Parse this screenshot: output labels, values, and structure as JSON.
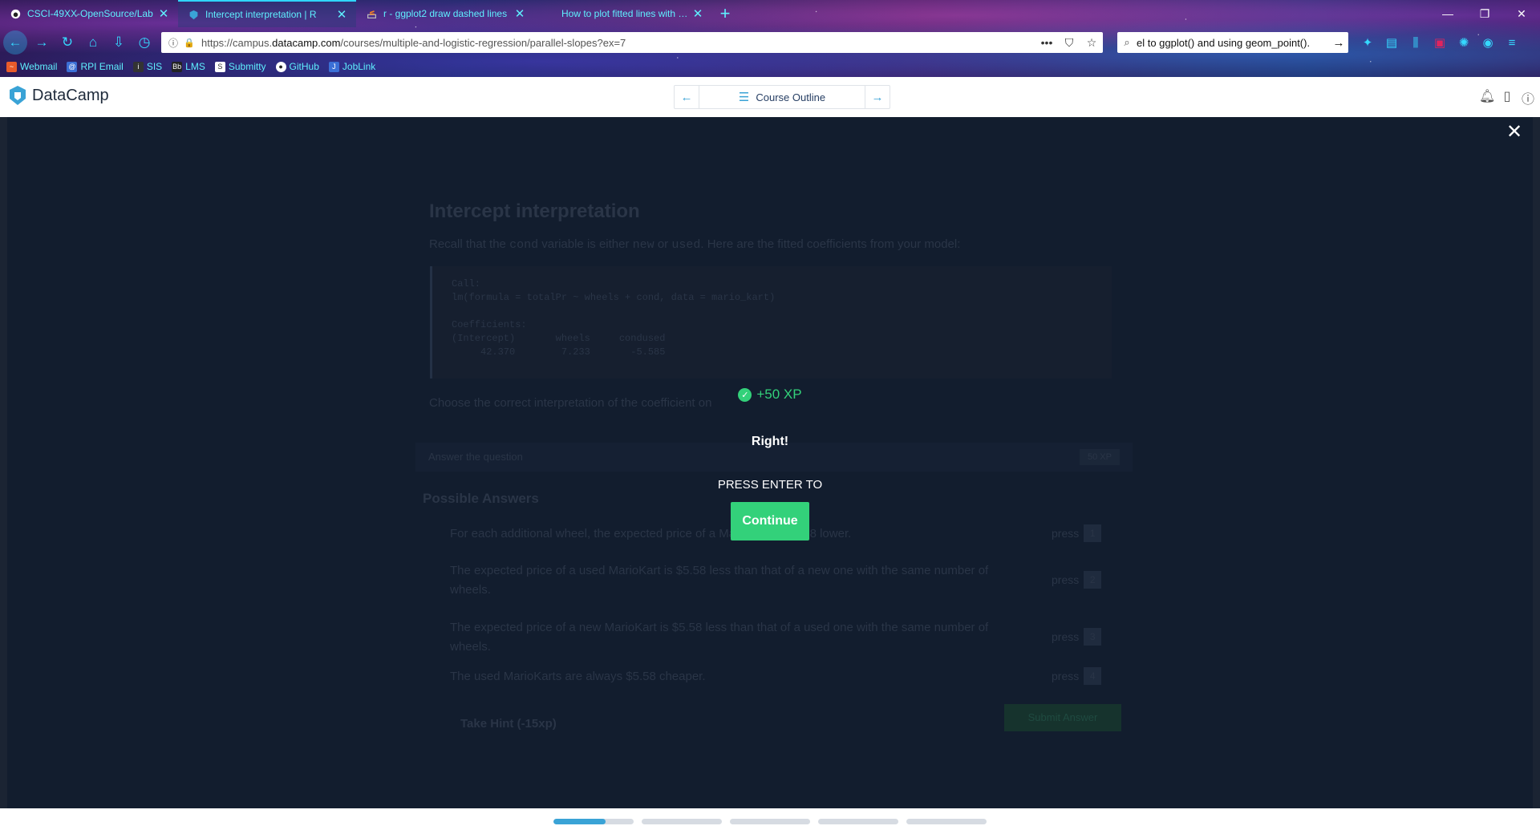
{
  "browser": {
    "tabs": [
      {
        "title": "CSCI-49XX-OpenSource/Lab",
        "active": false,
        "favicon": "github-icon"
      },
      {
        "title": "Intercept interpretation | R",
        "active": true,
        "favicon": "datacamp-icon"
      },
      {
        "title": "r - ggplot2 draw dashed lines",
        "active": false,
        "favicon": "stackoverflow-icon"
      },
      {
        "title": "How to plot fitted lines with ggplot",
        "active": false,
        "favicon": "page-icon"
      }
    ],
    "url_prefix": "https://campus.",
    "url_domain": "datacamp.com",
    "url_path": "/courses/multiple-and-logistic-regression/parallel-slopes?ex=7",
    "search_value": "el to ggplot() and using geom_point().",
    "bookmarks": [
      "Webmail",
      "RPI Email",
      "SIS",
      "LMS",
      "Submitty",
      "GitHub",
      "JobLink"
    ]
  },
  "header": {
    "brand": "DataCamp",
    "course_outline_label": "Course Outline"
  },
  "exercise": {
    "title": "Intercept interpretation",
    "intro_pre": "Recall that the",
    "intro_code1": "cond",
    "intro_mid1": "variable is either",
    "intro_code2": "new",
    "intro_mid2": "or",
    "intro_code3": "used",
    "intro_post": ". Here are the fitted coefficients from your model:",
    "code": "Call:\nlm(formula = totalPr ~ wheels + cond, data = mario_kart)\n\nCoefficients:\n(Intercept)       wheels     condused\n     42.370        7.233       -5.585",
    "question": "Choose the correct interpretation of the coefficient on",
    "answer_bar_label": "Answer the question",
    "answer_bar_xp": "50 XP",
    "possible_answers_heading": "Possible Answers",
    "answers": [
      {
        "text": "For each additional wheel, the expected price of a MarioKart is $5.58 lower.",
        "key": "1"
      },
      {
        "text": "The expected price of a used MarioKart is $5.58 less than that of a new one with the same number of wheels.",
        "key": "2"
      },
      {
        "text": "The expected price of a new MarioKart is $5.58 less than that of a used one with the same number of wheels.",
        "key": "3"
      },
      {
        "text": "The used MarioKarts are always $5.58 cheaper.",
        "key": "4"
      }
    ],
    "press_label": "press",
    "hint_label": "Take Hint (-15xp)",
    "submit_label": "Submit Answer"
  },
  "overlay": {
    "xp_gain": "+50 XP",
    "message": "Right!",
    "press_enter": "PRESS ENTER TO",
    "continue_label": "Continue"
  },
  "progress": {
    "segments": 5,
    "current_fraction": [
      0.65,
      0,
      0,
      0,
      0
    ]
  }
}
